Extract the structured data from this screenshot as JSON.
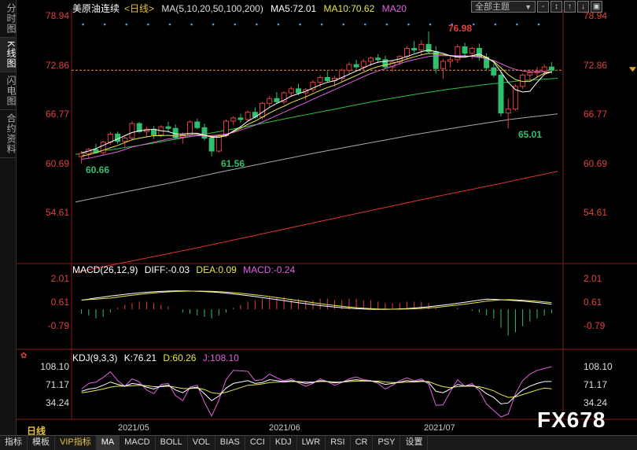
{
  "sidebar": {
    "tabs": [
      "分时图",
      "K线图",
      "闪电图",
      "合约资料"
    ],
    "active": 1
  },
  "header": {
    "fund_name": "美原油连续",
    "period_tag": "<日线>",
    "ma_label": "MA(5,10,20,50,100,200)",
    "ma5": "MA5:72.01",
    "ma10": "MA10:70.62",
    "ma20": "MA20",
    "select_label": "全部主题",
    "buttons": [
      "-",
      "↕",
      "↑",
      "↓",
      "▣"
    ]
  },
  "main_axis": {
    "ticks": [
      "78.94",
      "72.86",
      "66.77",
      "60.69",
      "54.61"
    ],
    "current_price": 72.2
  },
  "annotations": {
    "high": "76.98",
    "low1": "60.66",
    "low2": "61.56",
    "low3": "65.01"
  },
  "macd": {
    "title": "MACD(26,12,9)",
    "diff": "DIFF:-0.03",
    "dea": "DEA:0.09",
    "macd": "MACD:-0.24",
    "ticks": [
      "2.01",
      "0.61",
      "-0.79"
    ]
  },
  "kdj": {
    "title": "KDJ(9,3,3)",
    "k": "K:76.21",
    "d": "D:60.26",
    "j": "J:108.10",
    "ticks": [
      "108.10",
      "71.17",
      "34.24"
    ]
  },
  "x_axis": {
    "dates": [
      "2021/05",
      "2021/06",
      "2021/07"
    ]
  },
  "period_button": "日线",
  "bottom_tabs": [
    "指标",
    "模板",
    "VIP指标",
    "MA",
    "MACD",
    "BOLL",
    "VOL",
    "BIAS",
    "CCI",
    "KDJ",
    "LWR",
    "RSI",
    "CR",
    "PSY",
    "设置"
  ],
  "bottom_active": 3,
  "watermark": "FX678",
  "colors": {
    "up": "#e04040",
    "down": "#2fbf6f",
    "ma5": "#ffffff",
    "ma10": "#e8e84a",
    "ma20": "#e060e0",
    "ma50": "#30c040",
    "ma100": "#aaaaaa",
    "ma200": "#e03030"
  },
  "chart_data": {
    "type": "candlestick",
    "x_labels": [
      "2021/05",
      "2021/06",
      "2021/07"
    ],
    "ylim": [
      54.61,
      78.94
    ],
    "candles": [
      [
        61.5,
        62.2,
        60.66,
        61.9
      ],
      [
        61.9,
        62.6,
        61.3,
        62.4
      ],
      [
        62.4,
        63.1,
        61.9,
        62.0
      ],
      [
        62.0,
        63.5,
        61.8,
        63.3
      ],
      [
        63.3,
        64.6,
        63.0,
        64.3
      ],
      [
        64.3,
        64.6,
        63.1,
        63.4
      ],
      [
        63.4,
        64.0,
        62.7,
        63.8
      ],
      [
        63.8,
        65.9,
        63.5,
        65.6
      ],
      [
        65.6,
        65.8,
        64.4,
        64.6
      ],
      [
        64.6,
        65.2,
        64.0,
        64.9
      ],
      [
        64.9,
        65.3,
        63.7,
        64.2
      ],
      [
        64.2,
        65.4,
        63.9,
        65.2
      ],
      [
        65.2,
        65.8,
        64.6,
        65.0
      ],
      [
        65.0,
        65.5,
        63.6,
        63.9
      ],
      [
        63.9,
        64.5,
        63.1,
        64.2
      ],
      [
        64.2,
        66.0,
        64.0,
        65.8
      ],
      [
        65.8,
        66.2,
        64.9,
        65.1
      ],
      [
        65.1,
        65.6,
        63.5,
        63.8
      ],
      [
        63.8,
        64.2,
        61.56,
        62.2
      ],
      [
        62.2,
        64.3,
        62.0,
        64.1
      ],
      [
        64.1,
        66.1,
        63.9,
        65.9
      ],
      [
        65.9,
        66.5,
        65.4,
        66.3
      ],
      [
        66.3,
        66.8,
        65.7,
        66.1
      ],
      [
        66.1,
        67.2,
        65.9,
        67.0
      ],
      [
        67.0,
        67.6,
        66.2,
        66.4
      ],
      [
        66.4,
        68.3,
        66.1,
        68.1
      ],
      [
        68.1,
        69.0,
        67.7,
        68.7
      ],
      [
        68.7,
        69.5,
        68.1,
        68.3
      ],
      [
        68.3,
        69.6,
        68.0,
        69.4
      ],
      [
        69.4,
        70.2,
        68.9,
        69.9
      ],
      [
        69.9,
        70.5,
        69.1,
        69.4
      ],
      [
        69.4,
        70.0,
        68.5,
        69.8
      ],
      [
        69.8,
        71.0,
        69.5,
        70.7
      ],
      [
        70.7,
        71.6,
        70.1,
        71.3
      ],
      [
        71.3,
        72.1,
        70.7,
        70.9
      ],
      [
        70.9,
        71.5,
        70.2,
        71.2
      ],
      [
        71.2,
        72.4,
        70.8,
        72.2
      ],
      [
        72.2,
        73.2,
        71.8,
        72.9
      ],
      [
        72.9,
        73.5,
        72.3,
        72.6
      ],
      [
        72.6,
        73.6,
        72.1,
        73.3
      ],
      [
        73.3,
        73.9,
        72.7,
        73.7
      ],
      [
        73.7,
        74.2,
        73.1,
        73.5
      ],
      [
        73.5,
        74.0,
        72.3,
        72.6
      ],
      [
        72.6,
        73.4,
        72.0,
        73.2
      ],
      [
        73.2,
        74.1,
        72.8,
        73.9
      ],
      [
        73.9,
        75.2,
        73.5,
        74.9
      ],
      [
        74.9,
        75.8,
        74.3,
        74.7
      ],
      [
        74.7,
        75.9,
        74.0,
        75.4
      ],
      [
        75.4,
        76.98,
        74.2,
        74.5
      ],
      [
        74.5,
        75.2,
        71.8,
        72.4
      ],
      [
        72.4,
        73.6,
        71.1,
        73.3
      ],
      [
        73.3,
        74.0,
        72.5,
        73.5
      ],
      [
        73.5,
        75.4,
        73.1,
        75.1
      ],
      [
        75.1,
        75.6,
        74.0,
        74.3
      ],
      [
        74.3,
        75.1,
        73.6,
        74.9
      ],
      [
        74.9,
        75.5,
        73.4,
        73.8
      ],
      [
        73.8,
        74.3,
        72.2,
        72.5
      ],
      [
        72.5,
        73.0,
        71.3,
        71.6
      ],
      [
        71.6,
        72.0,
        66.5,
        66.9
      ],
      [
        66.9,
        68.7,
        65.01,
        67.4
      ],
      [
        67.4,
        70.5,
        67.2,
        70.2
      ],
      [
        70.2,
        71.8,
        69.9,
        71.6
      ],
      [
        71.6,
        72.3,
        70.9,
        71.9
      ],
      [
        71.9,
        72.6,
        71.2,
        72.1
      ],
      [
        72.1,
        72.9,
        71.6,
        72.6
      ],
      [
        72.6,
        73.2,
        71.8,
        72.2
      ]
    ],
    "ma5": [
      62.0,
      62.2,
      62.5,
      62.9,
      63.3,
      63.7,
      64.1,
      64.5,
      64.7,
      64.8,
      64.9,
      64.7,
      64.6,
      64.3,
      64.3,
      64.4,
      64.4,
      64.2,
      63.9,
      63.9,
      64.1,
      64.7,
      65.2,
      65.9,
      66.4,
      67.0,
      67.6,
      68.1,
      68.5,
      69.0,
      69.3,
      69.6,
      70.0,
      70.4,
      70.7,
      70.9,
      71.3,
      71.7,
      72.1,
      72.5,
      72.9,
      73.2,
      73.3,
      73.4,
      73.6,
      73.9,
      74.2,
      74.5,
      74.7,
      74.5,
      74.3,
      74.0,
      73.8,
      73.8,
      74.0,
      74.2,
      73.8,
      73.2,
      72.0,
      70.7,
      69.8,
      69.5,
      69.6,
      70.7,
      71.7,
      72.0
    ],
    "ma20": [
      61.2,
      61.3,
      61.5,
      61.7,
      61.9,
      62.1,
      62.4,
      62.7,
      62.9,
      63.1,
      63.3,
      63.5,
      63.7,
      63.8,
      63.9,
      64.0,
      64.1,
      64.1,
      64.1,
      64.2,
      64.3,
      64.5,
      64.8,
      65.1,
      65.4,
      65.8,
      66.2,
      66.6,
      67.0,
      67.4,
      67.8,
      68.2,
      68.6,
      69.0,
      69.4,
      69.8,
      70.2,
      70.6,
      71.0,
      71.4,
      71.8,
      72.1,
      72.4,
      72.7,
      73.0,
      73.3,
      73.5,
      73.7,
      73.9,
      74.0,
      74.0,
      74.0,
      74.0,
      74.0,
      73.9,
      73.8,
      73.6,
      73.4,
      73.0,
      72.6,
      72.3,
      72.1,
      72.0,
      72.0,
      72.0,
      72.0
    ],
    "ma50": [
      61.8,
      62.4,
      63.1,
      63.9,
      64.7,
      65.6,
      66.5,
      67.4,
      68.3,
      69.1,
      69.8,
      70.4,
      70.9,
      71.2
    ],
    "ma100": [
      55.9,
      57.1,
      58.3,
      59.6,
      60.8,
      62.0,
      63.1,
      64.2,
      65.2,
      66.1,
      66.8
    ],
    "ma200": [
      47.2,
      48.7,
      50.2,
      51.8,
      53.4,
      55.0,
      56.6,
      58.1,
      59.7
    ],
    "macd_hist": [
      -0.3,
      -0.4,
      -0.6,
      -0.5,
      -0.2,
      0.1,
      0.3,
      0.4,
      0.5,
      0.5,
      0.4,
      0.3,
      0.2,
      0.0,
      -0.2,
      -0.3,
      -0.4,
      -0.5,
      -0.6,
      -0.4,
      -0.2,
      0.1,
      0.3,
      0.5,
      0.6,
      0.7,
      0.8,
      0.8,
      0.8,
      0.7,
      0.7,
      0.6,
      0.6,
      0.7,
      0.7,
      0.6,
      0.6,
      0.7,
      0.7,
      0.6,
      0.6,
      0.5,
      0.4,
      0.4,
      0.4,
      0.5,
      0.5,
      0.5,
      0.4,
      0.1,
      0.0,
      0.0,
      0.1,
      0.0,
      -0.1,
      -0.2,
      -0.4,
      -0.6,
      -1.2,
      -1.7,
      -1.5,
      -1.1,
      -0.8,
      -0.6,
      -0.4,
      -0.24
    ],
    "kdj_k": [
      55,
      60,
      62,
      68,
      75,
      70,
      66,
      72,
      70,
      64,
      60,
      66,
      68,
      58,
      52,
      62,
      64,
      50,
      35,
      45,
      62,
      72,
      75,
      78,
      72,
      74,
      80,
      78,
      76,
      78,
      75,
      72,
      74,
      78,
      76,
      73,
      75,
      78,
      80,
      78,
      77,
      75,
      70,
      72,
      75,
      78,
      76,
      78,
      74,
      55,
      52,
      60,
      70,
      66,
      68,
      62,
      50,
      42,
      28,
      30,
      45,
      58,
      66,
      72,
      76,
      76.21
    ],
    "kdj_d": [
      52,
      54,
      57,
      60,
      64,
      66,
      66,
      67,
      68,
      67,
      65,
      65,
      66,
      64,
      61,
      61,
      62,
      59,
      52,
      50,
      53,
      58,
      63,
      68,
      69,
      71,
      74,
      75,
      75,
      76,
      76,
      75,
      75,
      76,
      76,
      75,
      75,
      76,
      77,
      77,
      77,
      77,
      75,
      74,
      74,
      75,
      75,
      76,
      76,
      70,
      65,
      63,
      65,
      66,
      66,
      65,
      61,
      56,
      48,
      42,
      43,
      48,
      53,
      58,
      62,
      60.26
    ],
    "kdj_j": [
      60,
      72,
      75,
      85,
      97,
      78,
      66,
      82,
      75,
      58,
      50,
      70,
      72,
      46,
      35,
      64,
      68,
      32,
      2,
      36,
      80,
      100,
      99,
      98,
      78,
      80,
      92,
      84,
      78,
      82,
      73,
      66,
      72,
      82,
      76,
      68,
      74,
      82,
      86,
      80,
      78,
      72,
      60,
      68,
      78,
      84,
      78,
      82,
      70,
      25,
      26,
      54,
      80,
      66,
      72,
      56,
      28,
      14,
      0,
      6,
      50,
      78,
      92,
      100,
      104,
      108.1
    ]
  }
}
